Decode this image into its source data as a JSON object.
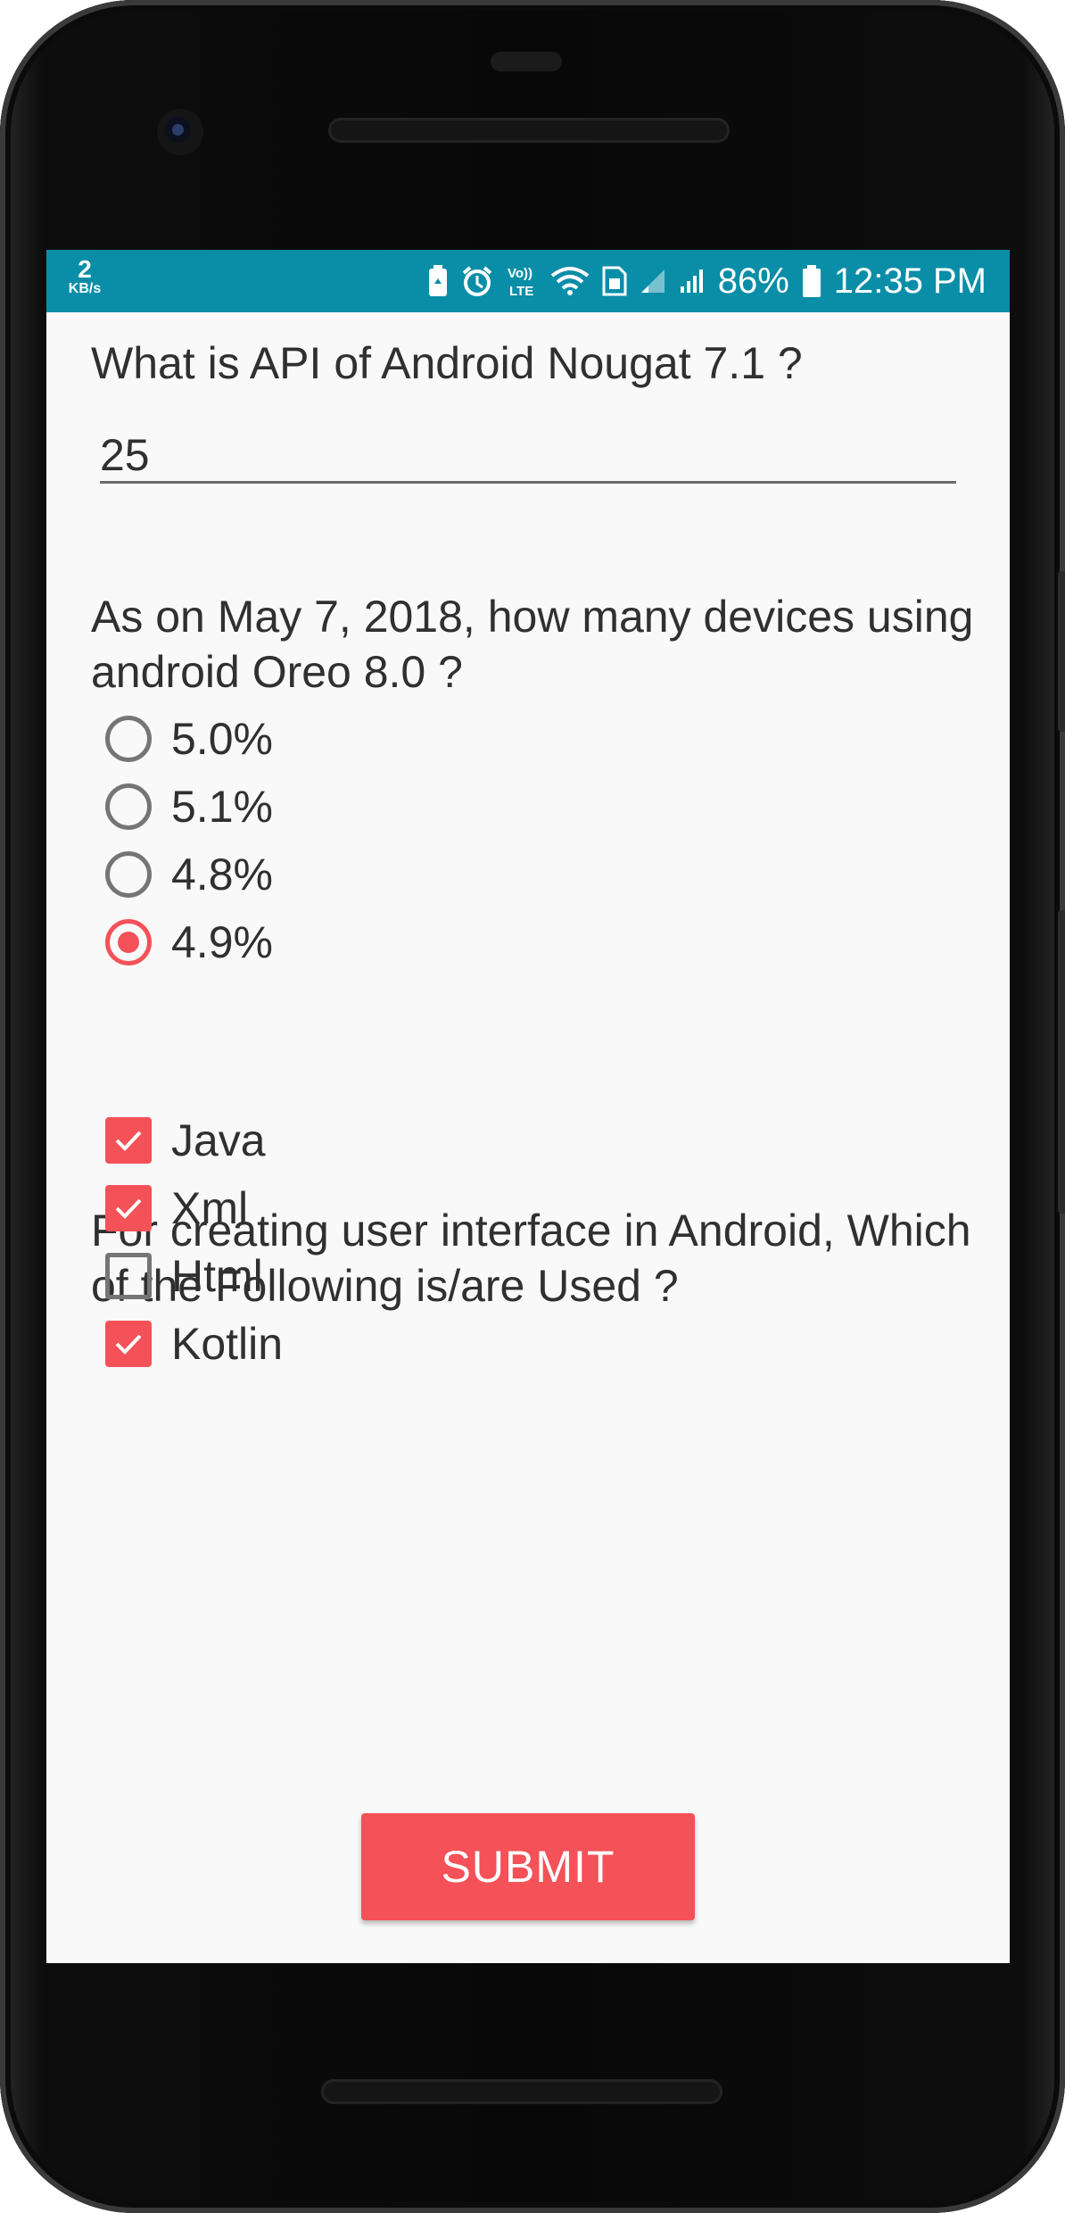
{
  "status_bar": {
    "net_speed_value": "2",
    "net_speed_unit": "KB/s",
    "volte_label": "Vo)) LTE",
    "battery_percent": "86%",
    "time": "12:35 PM",
    "background_color": "#0a8ea8"
  },
  "form": {
    "question1": "What is API of Android Nougat 7.1 ?",
    "answer1_value": "25",
    "question2": "As on May 7, 2018, how many devices using android Oreo 8.0 ?",
    "options": [
      {
        "label": "5.0%",
        "checked": false
      },
      {
        "label": "5.1%",
        "checked": false
      },
      {
        "label": "4.8%",
        "checked": false
      },
      {
        "label": "4.9%",
        "checked": true
      }
    ],
    "question3": "For creating user interface in Android, Which of the Following is/are Used ?",
    "checkboxes": [
      {
        "label": "Java",
        "checked": true
      },
      {
        "label": "Xml",
        "checked": true
      },
      {
        "label": "Html",
        "checked": false
      },
      {
        "label": "Kotlin",
        "checked": true
      }
    ],
    "submit_label": "SUBMIT",
    "accent_color": "#f45158"
  }
}
